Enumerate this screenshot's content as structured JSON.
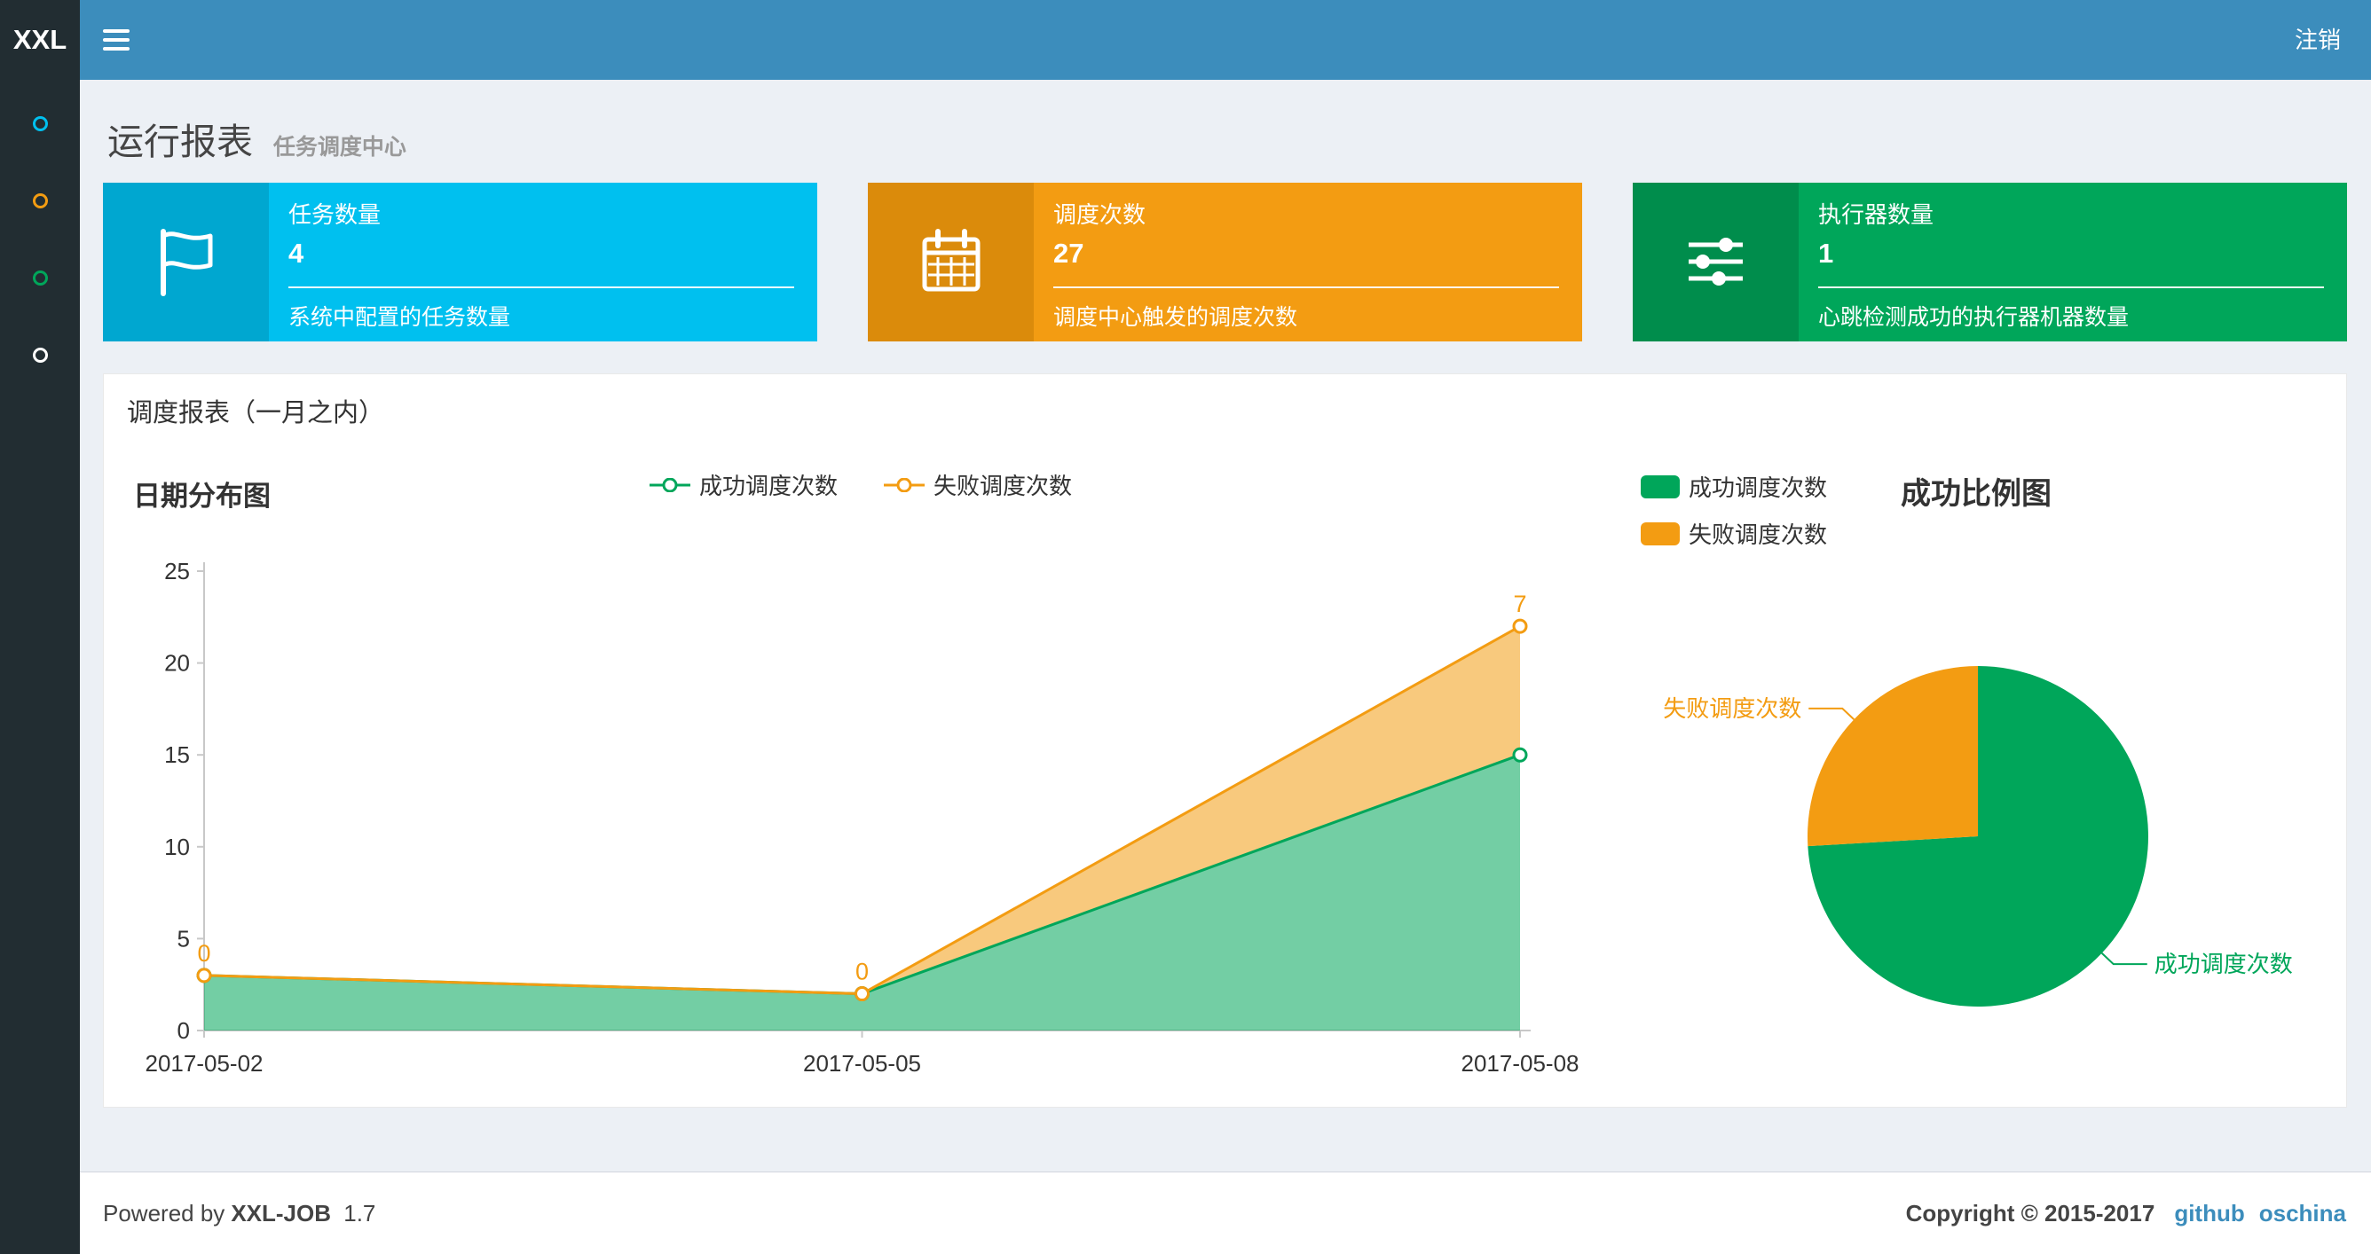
{
  "navbar": {
    "logo": "XXL",
    "logout_label": "注销"
  },
  "sidebar": {
    "items": [
      {
        "icon": "circle-outline-icon",
        "color": "#00c0ef"
      },
      {
        "icon": "circle-outline-icon",
        "color": "#f39c12"
      },
      {
        "icon": "circle-outline-icon",
        "color": "#00a65a"
      },
      {
        "icon": "circle-outline-icon",
        "color": "#ffffff"
      }
    ]
  },
  "header": {
    "title": "运行报表",
    "subtitle": "任务调度中心"
  },
  "info_boxes": [
    {
      "title": "任务数量",
      "value": "4",
      "desc": "系统中配置的任务数量",
      "bg": "#00c0ef",
      "icon_bg": "#00a7d0",
      "icon": "flag-icon"
    },
    {
      "title": "调度次数",
      "value": "27",
      "desc": "调度中心触发的调度次数",
      "bg": "#f39c12",
      "icon_bg": "#db8b0b",
      "icon": "calendar-icon"
    },
    {
      "title": "执行器数量",
      "value": "1",
      "desc": "心跳检测成功的执行器机器数量",
      "bg": "#00a65a",
      "icon_bg": "#008d4c",
      "icon": "sliders-icon"
    }
  ],
  "panel": {
    "title": "调度报表（一月之内）"
  },
  "chart_data": [
    {
      "type": "area",
      "title": "日期分布图",
      "stacked": true,
      "categories": [
        "2017-05-02",
        "2017-05-05",
        "2017-05-08"
      ],
      "series": [
        {
          "name": "成功调度次数",
          "color": "#00a65a",
          "values": [
            3,
            2,
            15
          ],
          "show_labels": false
        },
        {
          "name": "失败调度次数",
          "color": "#f39c12",
          "values": [
            0,
            0,
            7
          ],
          "show_labels": true
        }
      ],
      "ylim": [
        0,
        25
      ],
      "yticks": [
        0,
        5,
        10,
        15,
        20,
        25
      ],
      "legend_position": "top-center",
      "grid": false
    },
    {
      "type": "pie",
      "title": "成功比例图",
      "slices": [
        {
          "name": "成功调度次数",
          "value": 20,
          "color": "#00a65a"
        },
        {
          "name": "失败调度次数",
          "value": 7,
          "color": "#f39c12"
        }
      ],
      "legend_position": "top-left"
    }
  ],
  "footer": {
    "powered_prefix": "Powered by",
    "brand": "XXL-JOB",
    "version": "1.7",
    "copyright": "Copyright © 2015-2017",
    "links": [
      {
        "label": "github"
      },
      {
        "label": "oschina"
      }
    ]
  }
}
